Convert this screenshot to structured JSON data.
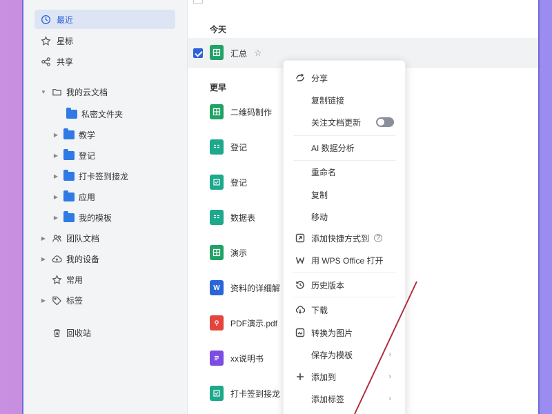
{
  "sidebar": {
    "recent": "最近",
    "starred": "星标",
    "shared": "共享",
    "my_cloud_docs": "我的云文档",
    "private_folder": "私密文件夹",
    "folders": [
      "教学",
      "登记",
      "打卡签到接龙",
      "应用",
      "我的模板"
    ],
    "team_docs": "团队文档",
    "my_devices": "我的设备",
    "frequent": "常用",
    "tags": "标签",
    "recycle_bin": "回收站"
  },
  "main": {
    "today_label": "今天",
    "earlier_label": "更早",
    "today_files": [
      {
        "name": "汇总",
        "type": "sheet"
      }
    ],
    "earlier_files": [
      {
        "name": "二维码制作",
        "type": "sheet"
      },
      {
        "name": "登记",
        "type": "form"
      },
      {
        "name": "登记",
        "type": "form"
      },
      {
        "name": "数据表",
        "type": "form"
      },
      {
        "name": "演示",
        "type": "sheet"
      },
      {
        "name": "资料的详细解",
        "type": "word"
      },
      {
        "name": "PDF演示.pdf",
        "type": "pdf"
      },
      {
        "name": "xx说明书",
        "type": "doc"
      },
      {
        "name": "打卡签到接龙",
        "type": "form"
      }
    ]
  },
  "context_menu": {
    "share": "分享",
    "copy_link": "复制链接",
    "follow_updates": "关注文档更新",
    "ai_analysis": "AI 数据分析",
    "rename": "重命名",
    "copy": "复制",
    "move": "移动",
    "add_shortcut": "添加快捷方式到",
    "open_wps": "用 WPS Office 打开",
    "history": "历史版本",
    "download": "下载",
    "to_image": "转换为图片",
    "save_template": "保存为模板",
    "add_to": "添加到",
    "add_tag": "添加标签"
  },
  "colors": {
    "accent": "#2f62d8",
    "annotation_line": "#b03040",
    "sheet_green": "#21a366"
  }
}
